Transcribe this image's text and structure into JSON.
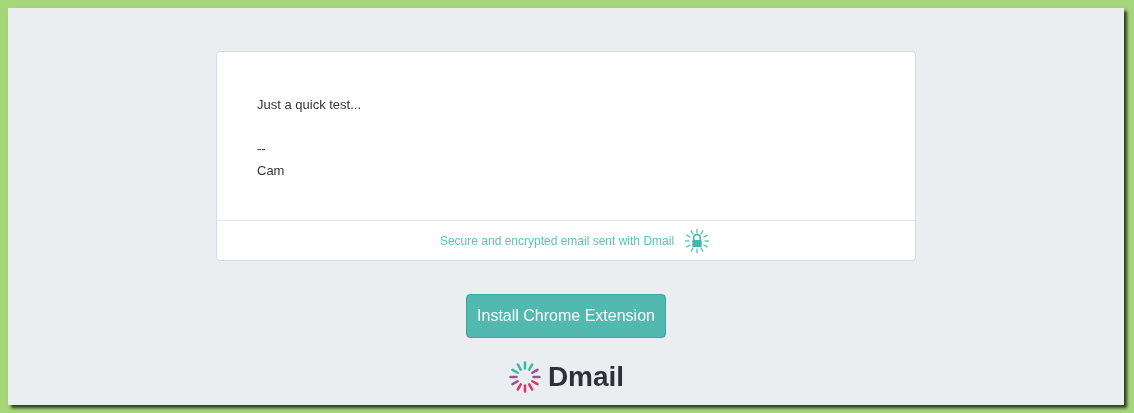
{
  "message": {
    "paragraphs": [
      [
        "Just a quick test..."
      ],
      [
        "--",
        "Cam"
      ]
    ]
  },
  "footer": {
    "text": "Secure and encrypted email sent with Dmail"
  },
  "install_button": {
    "label": "Install Chrome Extension"
  },
  "brand": {
    "name": "Dmail"
  }
}
